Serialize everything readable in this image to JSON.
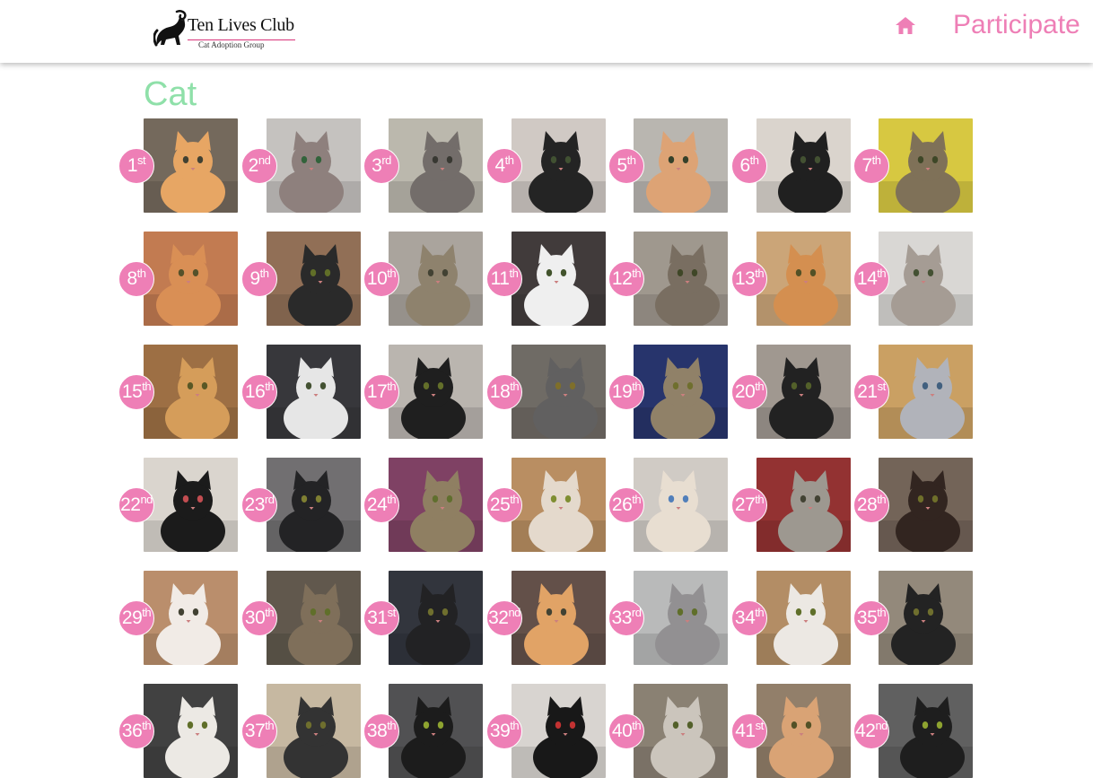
{
  "header": {
    "logo": {
      "main_text": "Ten Lives Club",
      "sub_text": "Cat Adoption Group"
    },
    "home_icon": "home-icon",
    "nav_participate": "Participate"
  },
  "page": {
    "title": "Cat"
  },
  "colors": {
    "accent_pink": "#ee7fb6",
    "title_green": "#8fe0a9"
  },
  "entries": [
    {
      "number": "1",
      "suffix": "st",
      "photo": {
        "bg": "#6f6356",
        "cat": "#e6a35e",
        "eye": "#3a3a2a"
      }
    },
    {
      "number": "2",
      "suffix": "nd",
      "photo": {
        "bg": "#c3c0bd",
        "cat": "#8a7b78",
        "eye": "#2a5d33"
      }
    },
    {
      "number": "3",
      "suffix": "rd",
      "photo": {
        "bg": "#b9b6aa",
        "cat": "#6e6864",
        "eye": "#30302a"
      }
    },
    {
      "number": "4",
      "suffix": "th",
      "photo": {
        "bg": "#cfc7c2",
        "cat": "#1c1c1c",
        "eye": "#3a4a2a"
      }
    },
    {
      "number": "5",
      "suffix": "th",
      "photo": {
        "bg": "#b7b3ad",
        "cat": "#dca070",
        "eye": "#2d3a22"
      }
    },
    {
      "number": "6",
      "suffix": "th",
      "photo": {
        "bg": "#d9d3cb",
        "cat": "#171717",
        "eye": "#3c4a2a"
      }
    },
    {
      "number": "7",
      "suffix": "th",
      "photo": {
        "bg": "#d6c63a",
        "cat": "#7a6c52",
        "eye": "#37401f"
      }
    },
    {
      "number": "8",
      "suffix": "th",
      "photo": {
        "bg": "#c0764a",
        "cat": "#d88b4f",
        "eye": "#4f4a22"
      }
    },
    {
      "number": "9",
      "suffix": "th",
      "photo": {
        "bg": "#8d6a50",
        "cat": "#222222",
        "eye": "#5b6a20"
      }
    },
    {
      "number": "10",
      "suffix": "th",
      "photo": {
        "bg": "#a7a19a",
        "cat": "#8a7d68",
        "eye": "#3b3b2b"
      }
    },
    {
      "number": "11",
      "suffix": "th",
      "photo": {
        "bg": "#3a3434",
        "cat": "#efefef",
        "eye": "#3b4d24"
      }
    },
    {
      "number": "12",
      "suffix": "th",
      "photo": {
        "bg": "#9c948a",
        "cat": "#74695b",
        "eye": "#38401f"
      }
    },
    {
      "number": "13",
      "suffix": "th",
      "photo": {
        "bg": "#c9a273",
        "cat": "#d38b49",
        "eye": "#4d4a1e"
      }
    },
    {
      "number": "14",
      "suffix": "th",
      "photo": {
        "bg": "#d8d6d3",
        "cat": "#a29890",
        "eye": "#3d4a2b"
      }
    },
    {
      "number": "15",
      "suffix": "th",
      "photo": {
        "bg": "#9a6a3d",
        "cat": "#d49a54",
        "eye": "#54521d"
      }
    },
    {
      "number": "16",
      "suffix": "th",
      "photo": {
        "bg": "#2f2f33",
        "cat": "#e5e5e5",
        "eye": "#3c4a2a"
      }
    },
    {
      "number": "17",
      "suffix": "th",
      "photo": {
        "bg": "#b8b2ac",
        "cat": "#161616",
        "eye": "#5d6a22"
      }
    },
    {
      "number": "18",
      "suffix": "th",
      "photo": {
        "bg": "#6a655f",
        "cat": "#5b5a5a",
        "eye": "#7a6a22"
      }
    },
    {
      "number": "19",
      "suffix": "th",
      "photo": {
        "bg": "#1f2c66",
        "cat": "#8c7c62",
        "eye": "#6a6a26"
      }
    },
    {
      "number": "20",
      "suffix": "th",
      "photo": {
        "bg": "#9d948c",
        "cat": "#1a1a1a",
        "eye": "#4d5a22"
      }
    },
    {
      "number": "21",
      "suffix": "st",
      "photo": {
        "bg": "#c89d5d",
        "cat": "#aeb0b8",
        "eye": "#3b5a7a"
      }
    },
    {
      "number": "22",
      "suffix": "nd",
      "photo": {
        "bg": "#d9d4cc",
        "cat": "#121212",
        "eye": "#c0464a"
      }
    },
    {
      "number": "23",
      "suffix": "rd",
      "photo": {
        "bg": "#6c6a6c",
        "cat": "#1b1b1d",
        "eye": "#7a7a2a"
      }
    },
    {
      "number": "24",
      "suffix": "th",
      "photo": {
        "bg": "#7a3a5e",
        "cat": "#8b7a5c",
        "eye": "#5a6a26"
      }
    },
    {
      "number": "25",
      "suffix": "th",
      "photo": {
        "bg": "#b78a5c",
        "cat": "#e3d8ca",
        "eye": "#7a8a2a"
      }
    },
    {
      "number": "26",
      "suffix": "th",
      "photo": {
        "bg": "#cfc9c3",
        "cat": "#e8ddd0",
        "eye": "#4a7ab8"
      }
    },
    {
      "number": "27",
      "suffix": "th",
      "photo": {
        "bg": "#8f2a2a",
        "cat": "#9a948c",
        "eye": "#3b3b2b"
      }
    },
    {
      "number": "28",
      "suffix": "th",
      "photo": {
        "bg": "#6e5e52",
        "cat": "#2a1d17",
        "eye": "#6a6a22"
      }
    },
    {
      "number": "29",
      "suffix": "th",
      "photo": {
        "bg": "#b88a66",
        "cat": "#f1ebe5",
        "eye": "#3b3b2b"
      }
    },
    {
      "number": "30",
      "suffix": "th",
      "photo": {
        "bg": "#5b5246",
        "cat": "#7a6a54",
        "eye": "#5a6a22"
      }
    },
    {
      "number": "31",
      "suffix": "st",
      "photo": {
        "bg": "#2a2d36",
        "cat": "#1a1a1c",
        "eye": "#6a6a26"
      }
    },
    {
      "number": "32",
      "suffix": "nd",
      "photo": {
        "bg": "#5d4942",
        "cat": "#e0a060",
        "eye": "#3b3b2b"
      }
    },
    {
      "number": "33",
      "suffix": "rd",
      "photo": {
        "bg": "#b7b8b8",
        "cat": "#8e8c8e",
        "eye": "#5a6a22"
      }
    },
    {
      "number": "34",
      "suffix": "th",
      "photo": {
        "bg": "#b0895f",
        "cat": "#ece8e2",
        "eye": "#5a6a22"
      }
    },
    {
      "number": "35",
      "suffix": "th",
      "photo": {
        "bg": "#8f8576",
        "cat": "#1b1b1b",
        "eye": "#6a6a26"
      }
    },
    {
      "number": "36",
      "suffix": "th",
      "photo": {
        "bg": "#3a3a3a",
        "cat": "#ece9e3",
        "eye": "#5a6a22"
      }
    },
    {
      "number": "37",
      "suffix": "th",
      "photo": {
        "bg": "#c4b69e",
        "cat": "#2b2b2b",
        "eye": "#6a6a26"
      }
    },
    {
      "number": "38",
      "suffix": "th",
      "photo": {
        "bg": "#4a4a4c",
        "cat": "#131313",
        "eye": "#8aa028"
      }
    },
    {
      "number": "39",
      "suffix": "th",
      "photo": {
        "bg": "#d7d3cf",
        "cat": "#0f0f0f",
        "eye": "#c02a2a"
      }
    },
    {
      "number": "40",
      "suffix": "th",
      "photo": {
        "bg": "#867c6e",
        "cat": "#c9c3ba",
        "eye": "#4d5a22"
      }
    },
    {
      "number": "41",
      "suffix": "st",
      "photo": {
        "bg": "#8e7a64",
        "cat": "#d8a070",
        "eye": "#4d4a1e"
      }
    },
    {
      "number": "42",
      "suffix": "nd",
      "photo": {
        "bg": "#5a5a5a",
        "cat": "#151515",
        "eye": "#8aa028"
      }
    }
  ]
}
